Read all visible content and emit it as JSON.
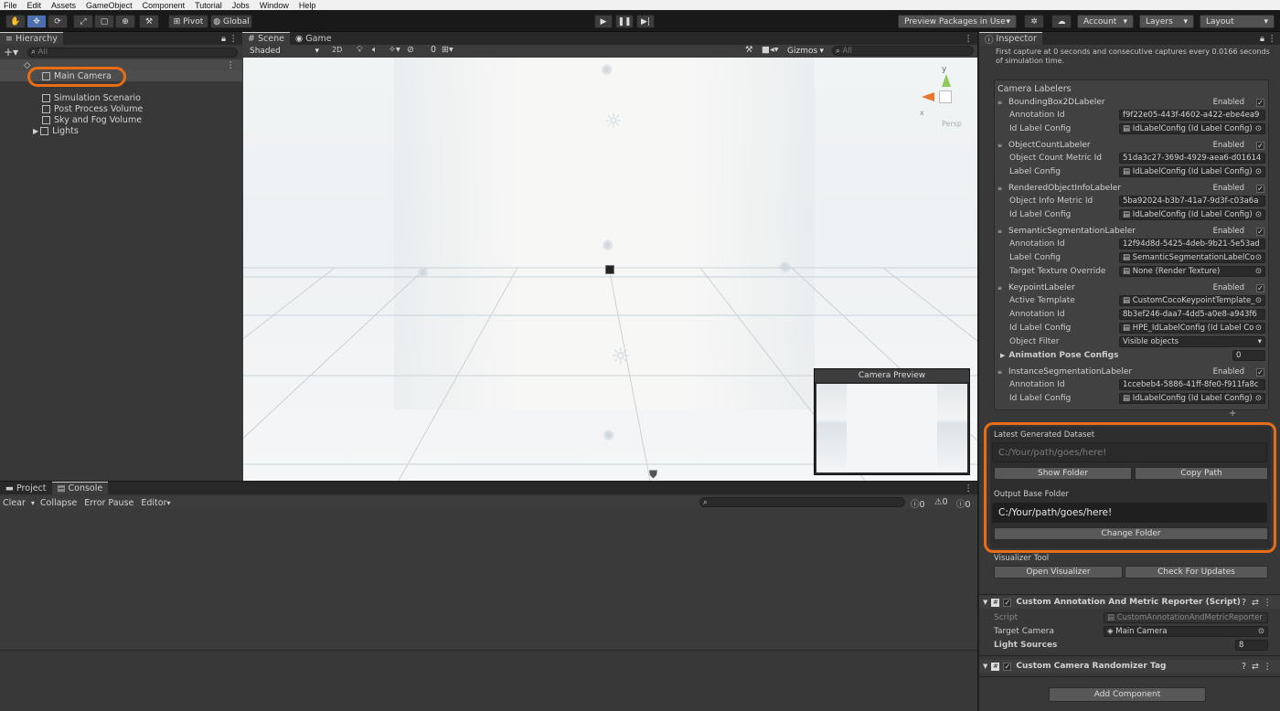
{
  "menu": [
    "File",
    "Edit",
    "Assets",
    "GameObject",
    "Component",
    "Tutorial",
    "Jobs",
    "Window",
    "Help"
  ],
  "toolbar": {
    "pivot": "Pivot",
    "global": "Global",
    "preview_packages": "Preview Packages in Use",
    "account": "Account",
    "layers": "Layers",
    "layout": "Layout"
  },
  "hierarchy": {
    "tab": "Hierarchy",
    "search_placeholder": "All",
    "items": [
      "Main Camera",
      "Simulation Scenario",
      "Post Process Volume",
      "Sky and Fog Volume",
      "Lights"
    ]
  },
  "scene": {
    "tab_scene": "Scene",
    "tab_game": "Game",
    "shading": "Shaded",
    "mode_2d": "2D",
    "layers_count": "0",
    "gizmos": "Gizmos",
    "search_placeholder": "All",
    "persp": "Persp",
    "camera_preview": "Camera Preview"
  },
  "console": {
    "tab_project": "Project",
    "tab_console": "Console",
    "clear": "Clear",
    "collapse": "Collapse",
    "error_pause": "Error Pause",
    "editor": "Editor",
    "counts": [
      "0",
      "0",
      "0"
    ]
  },
  "inspector": {
    "tab": "Inspector",
    "description": "First capture at 0 seconds and consecutive captures every 0.0166 seconds of simulation time.",
    "camera_labelers_title": "Camera Labelers",
    "enabled": "Enabled",
    "labelers": [
      {
        "name": "BoundingBox2DLabeler",
        "fields": [
          [
            "Annotation Id",
            "f9f22e05-443f-4602-a422-ebe4ea9"
          ],
          [
            "Id Label Config",
            "IdLabelConfig (Id Label Config)"
          ]
        ]
      },
      {
        "name": "ObjectCountLabeler",
        "fields": [
          [
            "Object Count Metric Id",
            "51da3c27-369d-4929-aea6-d01614"
          ],
          [
            "Label Config",
            "IdLabelConfig (Id Label Config)"
          ]
        ]
      },
      {
        "name": "RenderedObjectInfoLabeler",
        "fields": [
          [
            "Object Info Metric Id",
            "5ba92024-b3b7-41a7-9d3f-c03a6a"
          ],
          [
            "Id Label Config",
            "IdLabelConfig (Id Label Config)"
          ]
        ]
      },
      {
        "name": "SemanticSegmentationLabeler",
        "fields": [
          [
            "Annotation Id",
            "12f94d8d-5425-4deb-9b21-5e53ad"
          ],
          [
            "Label Config",
            "SemanticSegmentationLabelCor"
          ],
          [
            "Target Texture Override",
            "None (Render Texture)"
          ]
        ]
      },
      {
        "name": "KeypointLabeler",
        "fields": [
          [
            "Active Template",
            "CustomCocoKeypointTemplate_"
          ],
          [
            "Annotation Id",
            "8b3ef246-daa7-4dd5-a0e8-a943f6"
          ],
          [
            "Id Label Config",
            "HPE_IdLabelConfig (Id Label Co"
          ],
          [
            "Object Filter",
            "Visible objects"
          ]
        ],
        "extra_label": "Animation Pose Configs",
        "extra_value": "0"
      },
      {
        "name": "InstanceSegmentationLabeler",
        "fields": [
          [
            "Annotation Id",
            "1ccebeb4-5886-41ff-8fe0-f911fa8c"
          ],
          [
            "Id Label Config",
            "IdLabelConfig (Id Label Config)"
          ]
        ]
      }
    ],
    "latest_dataset_label": "Latest Generated Dataset",
    "latest_dataset_placeholder": "C:/Your/path/goes/here!",
    "show_folder": "Show Folder",
    "copy_path": "Copy Path",
    "output_base_label": "Output Base Folder",
    "output_base_path": "C:/Your/path/goes/here!",
    "change_folder": "Change Folder",
    "visualizer_label": "Visualizer Tool",
    "open_visualizer": "Open Visualizer",
    "check_updates": "Check For Updates",
    "reporter_title": "Custom Annotation And Metric Reporter (Script)",
    "script_label": "Script",
    "script_value": "CustomAnnotationAndMetricReporter",
    "target_camera_label": "Target Camera",
    "target_camera_value": "Main Camera",
    "light_sources_label": "Light Sources",
    "light_sources_value": "8",
    "randomizer_title": "Custom Camera Randomizer Tag",
    "add_component": "Add Component"
  },
  "colors": {
    "highlight": "#e96d16",
    "selection": "#2c5d87"
  }
}
